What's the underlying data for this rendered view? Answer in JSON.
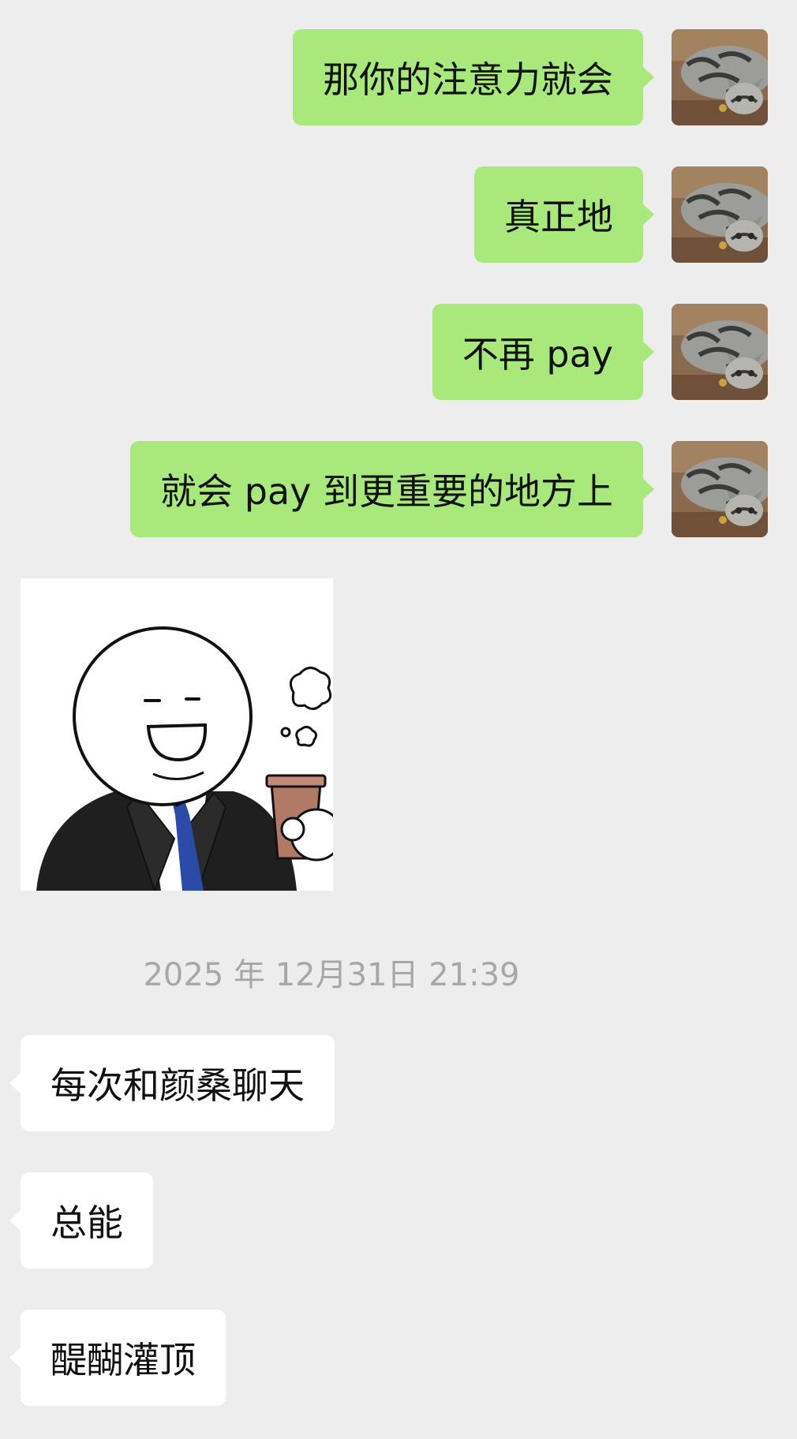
{
  "chat": {
    "sent_messages": [
      {
        "text": "那你的注意力就会",
        "avatar_icon": "cat-avatar-icon"
      },
      {
        "text": "真正地",
        "avatar_icon": "cat-avatar-icon"
      },
      {
        "text": "不再 pay",
        "avatar_icon": "cat-avatar-icon"
      },
      {
        "text": "就会 pay 到更重要的地方上",
        "avatar_icon": "cat-avatar-icon"
      }
    ],
    "sticker": {
      "icon": "suited-stickman-coffee-sticker"
    },
    "timestamp": "2025 年 12月31日 21:39",
    "received_messages": [
      {
        "text": "每次和颜桑聊天"
      },
      {
        "text": "总能"
      },
      {
        "text": "醍醐灌顶"
      }
    ]
  },
  "colors": {
    "background": "#ededed",
    "sent_bubble": "#a9e97b",
    "received_bubble": "#ffffff",
    "timestamp_text": "#a7a7a7"
  }
}
